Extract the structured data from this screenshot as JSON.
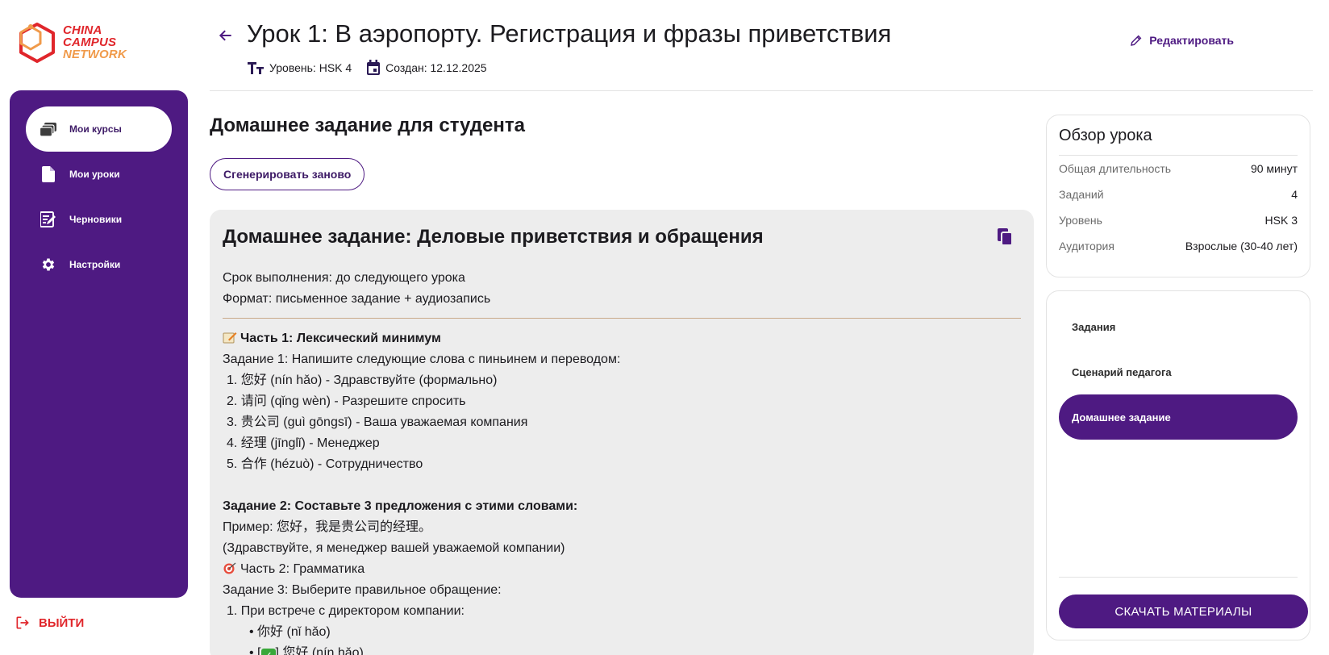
{
  "logo": {
    "line1": "CHINA",
    "line2": "CAMPUS",
    "line3": "NETWORK",
    "colors": {
      "red": "#e0262b",
      "orange": "#f09a4a"
    }
  },
  "sidebar": {
    "items": [
      {
        "label": "Мои курсы",
        "icon": "stack-icon",
        "active": true
      },
      {
        "label": "Мои уроки",
        "icon": "document-icon",
        "active": false
      },
      {
        "label": "Черновики",
        "icon": "edit-note-icon",
        "active": false
      },
      {
        "label": "Настройки",
        "icon": "gear-icon",
        "active": false
      }
    ],
    "logout_label": "ВЫЙТИ"
  },
  "header": {
    "title": "Урок 1: В аэропорту. Регистрация и фразы приветствия",
    "level": "Уровень: HSK 4",
    "created": "Создан: 12.12.2025",
    "edit_label": "Редактировать"
  },
  "main": {
    "section_title": "Домашнее задание для студента",
    "regen_label": "Сгенерировать заново",
    "homework": {
      "title": "Домашнее задание: Деловые приветствия и обращения",
      "deadline": "Срок выполнения: до следующего урока",
      "format": "Формат: письменное задание + аудиозапись",
      "part1_title": "Часть 1: Лексический минимум",
      "task1": "Задание 1: Напишите следующие слова с пиньинем и переводом:",
      "words": [
        "1. 您好 (nín hǎo) - Здравствуйте (формально)",
        "2. 请问 (qǐng wèn) - Разрешите спросить",
        "3. 贵公司 (guì gōngsī) - Ваша уважаемая компания",
        "4. 经理 (jīnglǐ) - Менеджер",
        "5. 合作 (hézuò) - Сотрудничество"
      ],
      "task2": "Задание 2: Составьте 3 предложения с этими словами:",
      "example": "Пример: 您好，我是贵公司的经理。",
      "example_translation": "(Здравствуйте, я менеджер вашей уважаемой компании)",
      "part2_title": "Часть 2: Грамматика",
      "task3": "Задание 3: Выберите правильное обращение:",
      "q1": "1. При встрече с директором компании:",
      "opt1": "• 你好 (nǐ hǎo)",
      "opt2_prefix": "• [",
      "opt2_suffix": "] 您好 (nín hǎo)"
    }
  },
  "overview": {
    "title": "Обзор урока",
    "rows": [
      {
        "key": "Общая длительность",
        "value": "90 минут"
      },
      {
        "key": "Заданий",
        "value": "4"
      },
      {
        "key": "Уровень",
        "value": "HSK 3"
      },
      {
        "key": "Аудитория",
        "value": "Взрослые (30-40 лет)"
      }
    ]
  },
  "tabs": {
    "items": [
      {
        "label": "Задания",
        "active": false
      },
      {
        "label": "Сценарий педагога",
        "active": false
      },
      {
        "label": "Домашнее задание",
        "active": true
      }
    ],
    "download_label": "СКАЧАТЬ МАТЕРИАЛЫ"
  },
  "colors": {
    "accent": "#4e1a82",
    "danger": "#e0262b"
  }
}
